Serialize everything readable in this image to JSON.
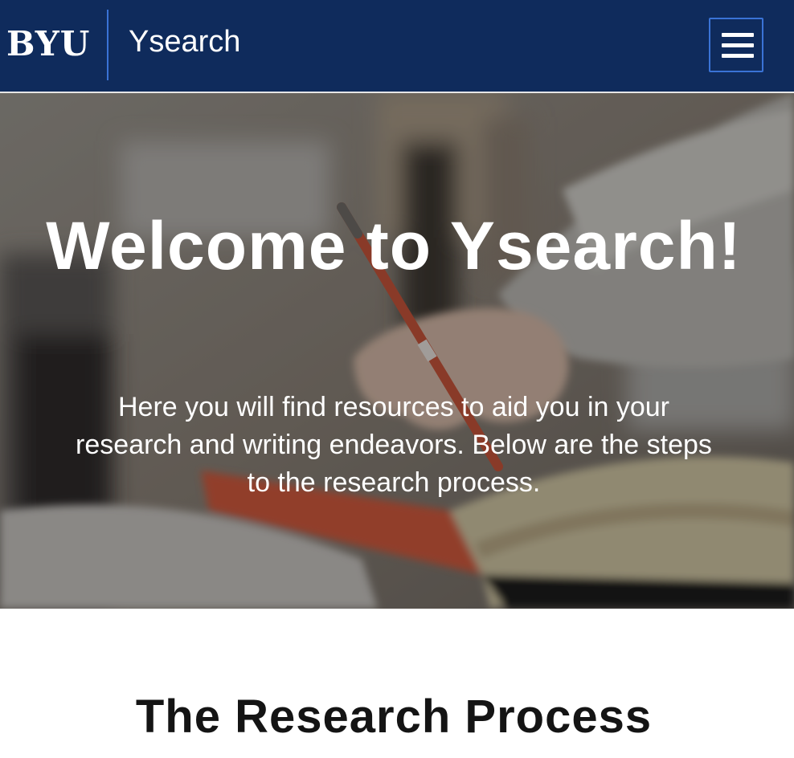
{
  "header": {
    "logo_text": "BYU",
    "site_title": "Ysearch",
    "menu_icon": "hamburger-menu-icon",
    "background_color": "#0f2b5c",
    "accent_color": "#3a73d6"
  },
  "hero": {
    "title": "Welcome to Ysearch!",
    "subtitle": "Here you will find resources to aid you in your research and writing endeavors. Below are the steps to the research process."
  },
  "main": {
    "section_title": "The Research Process"
  }
}
